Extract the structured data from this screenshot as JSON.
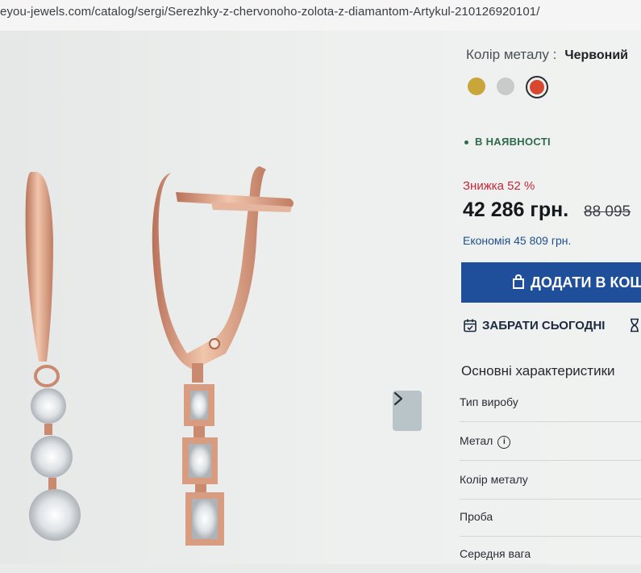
{
  "browser": {
    "url": "eyou-jewels.com/catalog/sergi/Serezhky-z-chervonoho-zolota-z-diamantom-Artykul-210126920101/"
  },
  "gallery": {
    "next_icon": "chevron-right-icon"
  },
  "product": {
    "metal_color_label": "Колір металу :",
    "metal_color_value": "Червоний",
    "swatches": [
      {
        "name": "gold",
        "color": "#c9a63a"
      },
      {
        "name": "silver",
        "color": "#c9cbcb"
      },
      {
        "name": "red",
        "color": "#d8482e",
        "selected": true
      }
    ],
    "stock_status": "В НАЯВНОСТІ",
    "discount": "Знижка 52 %",
    "price": "42 286 грн.",
    "old_price": "88 095",
    "saving": "Економія 45 809 грн.",
    "add_to_cart_label": "ДОДАТИ В КОШ",
    "pickup_today_label": "ЗАБРАТИ СЬОГОДНІ"
  },
  "specs": {
    "title": "Основні характеристики",
    "rows": [
      "Тип виробу",
      "Метал",
      "Колір металу",
      "Проба",
      "Середня вага"
    ]
  },
  "colors": {
    "accent": "#1f4f9a",
    "discount": "#c4283b",
    "in_stock": "#2f6a4c"
  }
}
